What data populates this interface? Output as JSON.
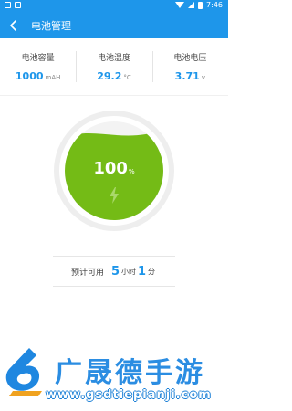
{
  "status_bar": {
    "time": "7:46"
  },
  "header": {
    "title": "电池管理"
  },
  "stats": [
    {
      "label": "电池容量",
      "value": "1000",
      "unit": "mAH"
    },
    {
      "label": "电池温度",
      "value": "29.2",
      "unit": "°C"
    },
    {
      "label": "电池电压",
      "value": "3.71",
      "unit": "v"
    }
  ],
  "battery": {
    "level_percent": 100,
    "level_text": "100",
    "percent_sign": "%"
  },
  "remaining": {
    "label": "预计可用",
    "hours": "5",
    "hours_unit": "小时",
    "minutes": "1",
    "minutes_unit": "分"
  },
  "watermark": {
    "title": "广晟德手游",
    "url": "www.gsdtiepianji.com"
  },
  "colors": {
    "primary": "#1e96ea",
    "battery_fill": "#74bb16",
    "ring": "#eeeeee"
  }
}
